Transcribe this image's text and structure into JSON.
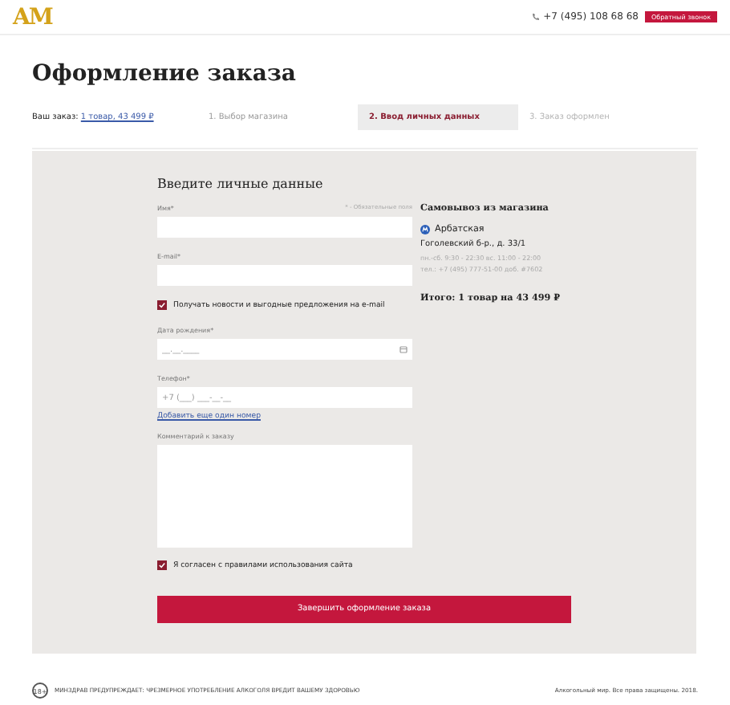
{
  "header": {
    "logo": "AM",
    "phone": "+7 (495) 108 68 68",
    "callback_button": "Обратный звонок"
  },
  "title": "Оформление заказа",
  "order_summary": {
    "label": "Ваш заказ:",
    "link": "1 товар, 43 499 ₽"
  },
  "steps": [
    {
      "label": "1. Выбор магазина",
      "selected": false,
      "done": true
    },
    {
      "label": "2. Ввод личных данных",
      "selected": true,
      "done": false
    },
    {
      "label": "3. Заказ оформлен",
      "selected": false,
      "done": false
    }
  ],
  "form": {
    "heading": "Введите личные данные",
    "required_note": "* - Обязательные поля",
    "fields": [
      {
        "kind": "input",
        "label": "Имя*"
      },
      {
        "kind": "input",
        "label": "E-mail*"
      },
      {
        "kind": "checkbox",
        "label": "Получать новости и выгодные предложения на e-mail",
        "checked": true
      },
      {
        "kind": "date",
        "label": "Дата рождения*",
        "placeholder": "__.__.____"
      },
      {
        "kind": "input",
        "label": "Телефон*",
        "placeholder": "+7 (___) ___-__-__"
      },
      {
        "kind": "link",
        "label": "Добавить еще один номер"
      },
      {
        "kind": "textarea",
        "label": "Комментарий к заказу"
      },
      {
        "kind": "checkbox",
        "label": "Я согласен с правилами использования сайта",
        "checked": true
      }
    ],
    "submit": "Завершить оформление заказа"
  },
  "pickup": {
    "title": "Самовывоз из магазина",
    "station": "Арбатская",
    "address": "Гоголевский б-р., д. 33/1",
    "hours": "пн.-сб. 9:30 - 22:30 вс. 11:00 - 22:00",
    "phone": "тел.: +7 (495) 777-51-00 доб. #7602",
    "total": "Итого: 1 товар на 43 499 ₽"
  },
  "footer": {
    "age": "18+",
    "warning": "МИНЗДРАВ ПРЕДУПРЕЖДАЕТ: ЧРЕЗМЕРНОЕ УПОТРЕБЛЕНИЕ АЛКОГОЛЯ ВРЕДИТ ВАШЕМУ ЗДОРОВЬЮ",
    "copyright": "Алкогольный мир. Все права защищены. 2018."
  }
}
